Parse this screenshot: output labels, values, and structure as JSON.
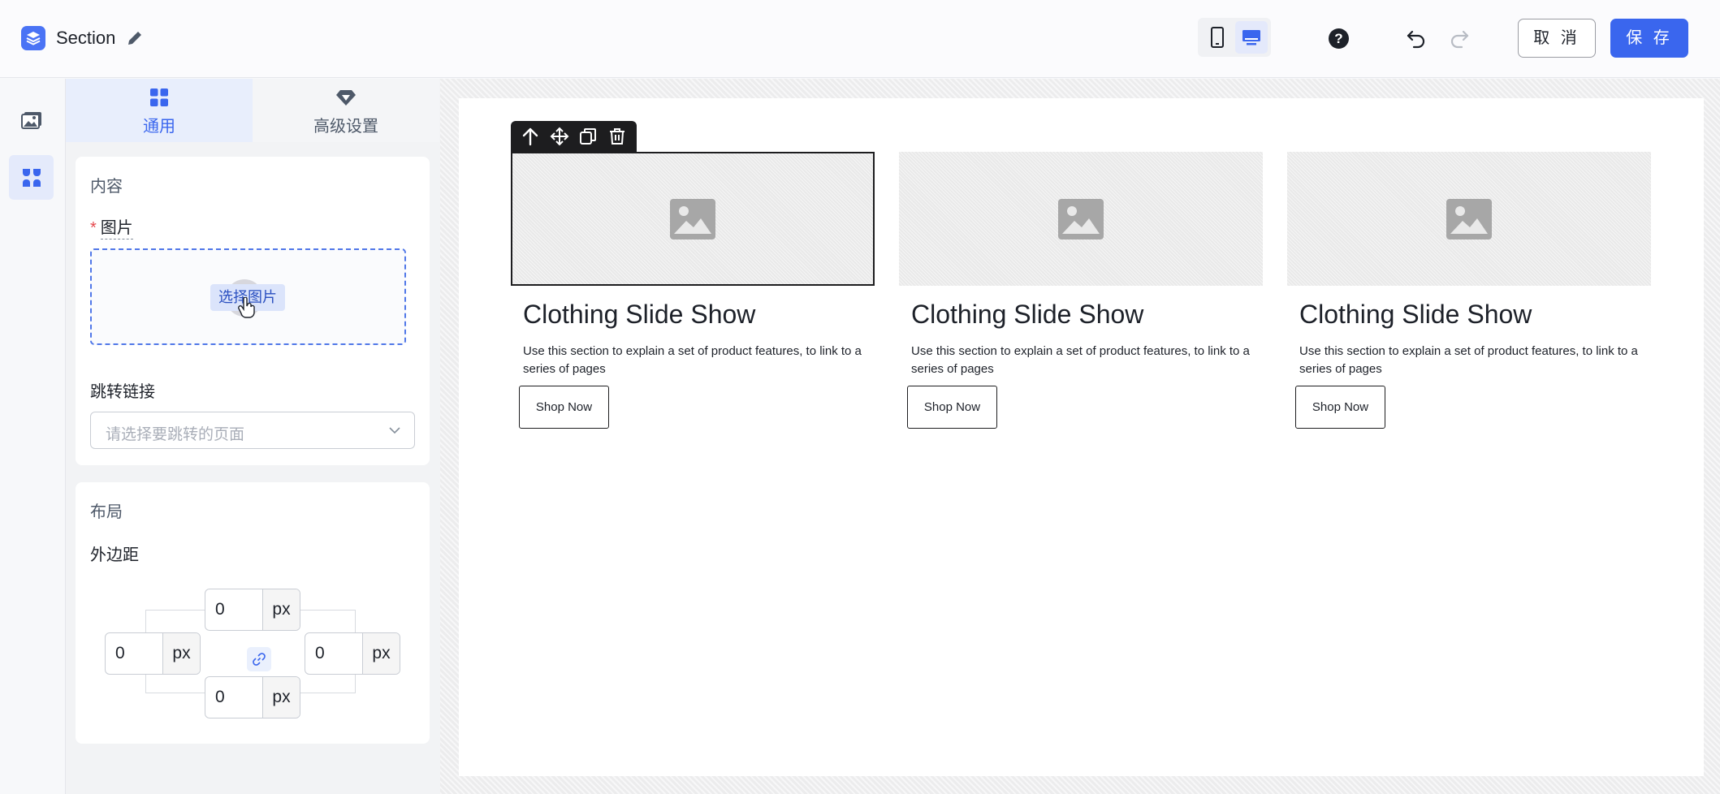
{
  "header": {
    "title": "Section",
    "help_glyph": "?",
    "cancel_label": "取 消",
    "save_label": "保 存",
    "icons": [
      "layers-logo-icon",
      "pencil-icon",
      "mobile-icon",
      "desktop-icon",
      "help-icon",
      "undo-icon",
      "redo-icon"
    ],
    "active_device": "desktop"
  },
  "rail": {
    "items": [
      {
        "icon": "image-gallery-icon",
        "active": false
      },
      {
        "icon": "components-icon",
        "active": true
      }
    ]
  },
  "panel": {
    "tabs": [
      {
        "label": "通用",
        "icon": "grid-icon",
        "active": true
      },
      {
        "label": "高级设置",
        "icon": "diamond-icon",
        "active": false
      }
    ],
    "content": {
      "title": "内容",
      "image_field": {
        "required_mark": "*",
        "label": "图片",
        "upload_label": "选择图片"
      },
      "link_field": {
        "label": "跳转链接",
        "placeholder": "请选择要跳转的页面"
      }
    },
    "layout": {
      "title": "布局",
      "margin": {
        "label": "外边距",
        "top": "0",
        "left": "0",
        "right": "0",
        "bottom": "0",
        "unit": "px"
      }
    }
  },
  "canvas": {
    "toolbar_icons": [
      "arrow-up-icon",
      "move-icon",
      "copy-icon",
      "delete-icon"
    ],
    "columns": [
      {
        "title": "Clothing Slide Show",
        "description": "Use this section to explain a set of product features, to link to a series of pages",
        "button": "Shop Now",
        "selected": true
      },
      {
        "title": "Clothing Slide Show",
        "description": "Use this section to explain a set of product features, to link to a series of pages",
        "button": "Shop Now",
        "selected": false
      },
      {
        "title": "Clothing Slide Show",
        "description": "Use this section to explain a set of product features, to link to a series of pages",
        "button": "Shop Now",
        "selected": false
      }
    ]
  },
  "colors": {
    "accent": "#3a66ee",
    "required": "#e5484d",
    "text": "#1d2129"
  }
}
